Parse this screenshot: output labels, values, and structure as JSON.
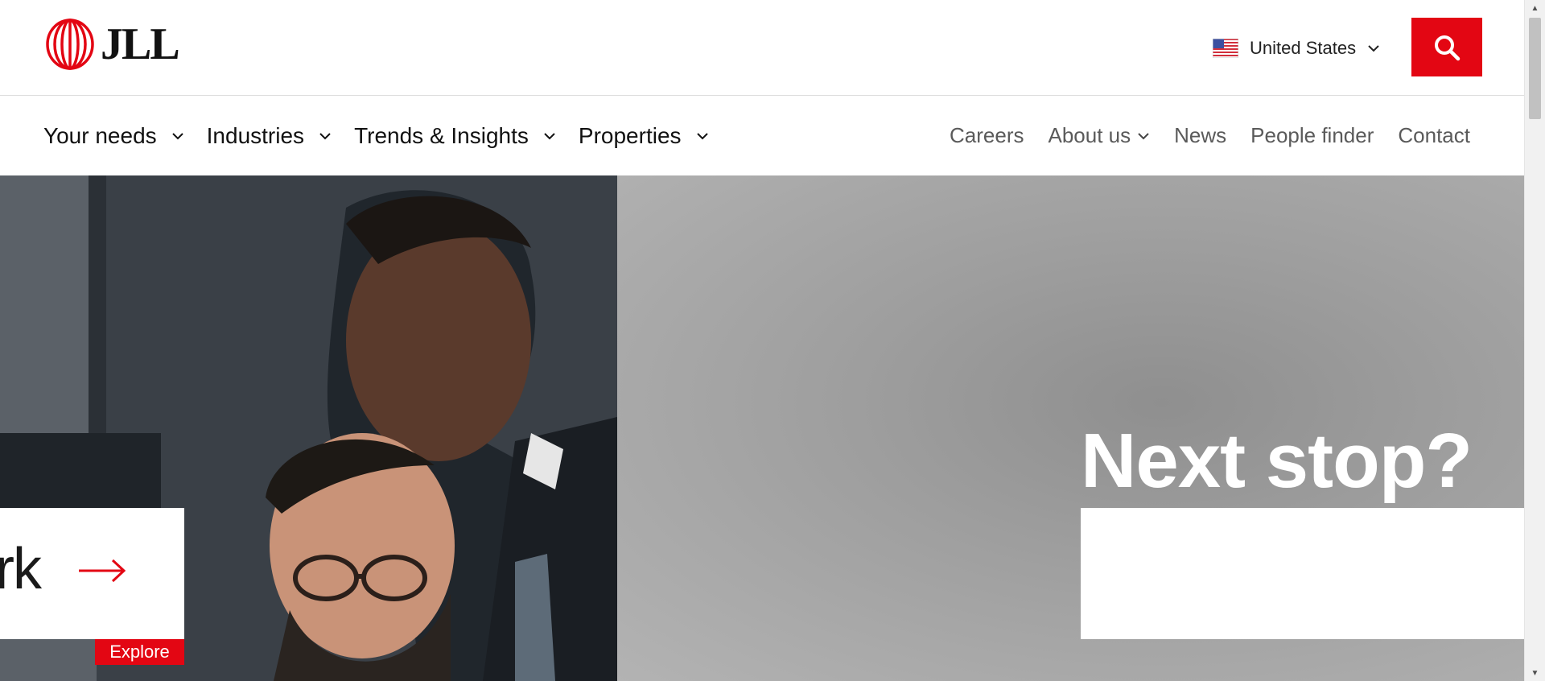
{
  "header": {
    "logo_text": "JLL",
    "country": "United States",
    "icons": {
      "flag": "us-flag-icon",
      "search": "search-icon",
      "dropdown": "chevron-down-icon"
    }
  },
  "nav": {
    "primary": [
      {
        "label": "Your needs",
        "has_dropdown": true
      },
      {
        "label": "Industries",
        "has_dropdown": true
      },
      {
        "label": "Trends & Insights",
        "has_dropdown": true
      },
      {
        "label": "Properties",
        "has_dropdown": true
      }
    ],
    "secondary": [
      {
        "label": "Careers",
        "has_dropdown": false
      },
      {
        "label": "About us",
        "has_dropdown": true
      },
      {
        "label": "News",
        "has_dropdown": false
      },
      {
        "label": "People finder",
        "has_dropdown": false
      },
      {
        "label": "Contact",
        "has_dropdown": false
      }
    ]
  },
  "hero": {
    "left_card_text": "rk",
    "left_tag": "Explore",
    "right_heading": "Next stop?"
  },
  "colors": {
    "brand_red": "#e30613",
    "text_dark": "#111111",
    "text_muted": "#5a5a5a",
    "hero_grey": "#9e9e9e"
  }
}
